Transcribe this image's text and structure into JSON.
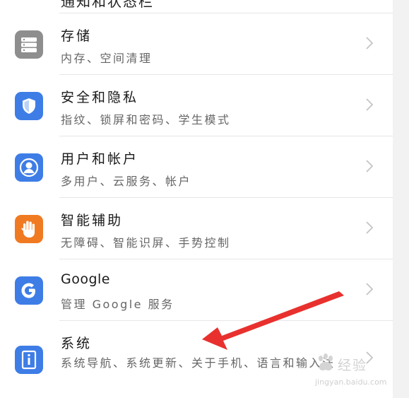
{
  "cut_off_row": {
    "title": "通知和状态栏"
  },
  "items": [
    {
      "title": "存储",
      "subtitle": "内存、空间清理",
      "icon": "storage-icon",
      "icon_color": "#8e8e8e"
    },
    {
      "title": "安全和隐私",
      "subtitle": "指纹、锁屏和密码、学生模式",
      "icon": "shield-icon",
      "icon_color": "#3e7de6"
    },
    {
      "title": "用户和帐户",
      "subtitle": "多用户、云服务、帐户",
      "icon": "user-icon",
      "icon_color": "#3e7de6"
    },
    {
      "title": "智能辅助",
      "subtitle": "无障碍、智能识屏、手势控制",
      "icon": "hand-icon",
      "icon_color": "#f07a22"
    },
    {
      "title": "Google",
      "subtitle": "管理 Google 服务",
      "icon": "google-icon",
      "icon_color": "#3e7de6"
    },
    {
      "title": "系统",
      "subtitle": "系统导航、系统更新、关于手机、语言和输入法",
      "icon": "system-info-icon",
      "icon_color": "#3e7de6"
    }
  ],
  "watermark": {
    "brand": "经验",
    "url": "jingyan.baidu.com"
  },
  "annotation": {
    "arrow_color": "#e8312e"
  }
}
